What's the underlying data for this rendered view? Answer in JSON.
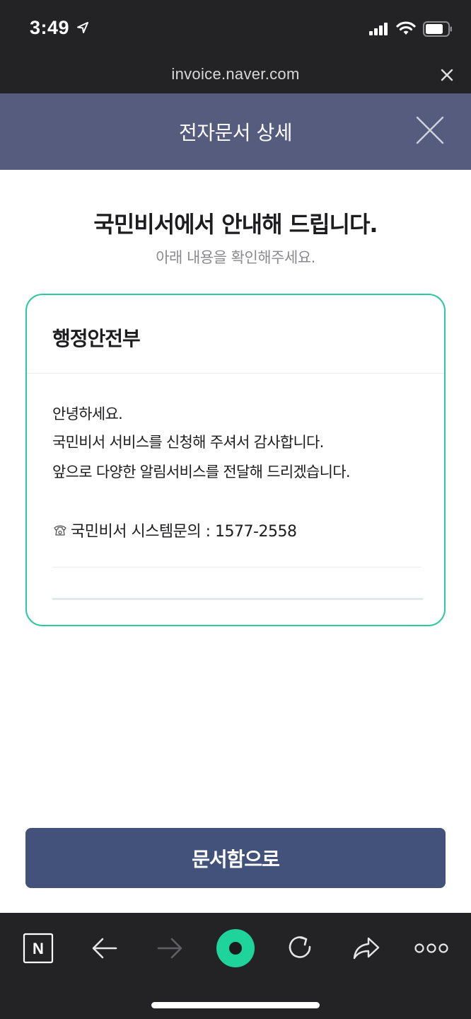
{
  "status_bar": {
    "time": "3:49"
  },
  "url_bar": {
    "url": "invoice.naver.com"
  },
  "header": {
    "title": "전자문서 상세"
  },
  "intro": {
    "title": "국민비서에서 안내해 드립니다.",
    "subtitle": "아래 내용을 확인해주세요."
  },
  "card": {
    "sender": "행정안전부",
    "lines": [
      "안녕하세요.",
      "국민비서 서비스를 신청해 주셔서 감사합니다.",
      "앞으로 다양한 알림서비스를 전달해 드리겠습니다."
    ],
    "phone_text": "국민비서 시스템문의 : 1577-2558"
  },
  "cta": {
    "label": "문서함으로"
  },
  "toolbar": {
    "n_label": "N"
  },
  "colors": {
    "header_bg": "#555c7e",
    "card_border": "#2cc9a1",
    "cta_bg": "#42527a",
    "green_accent": "#1ed49a",
    "chrome_bg": "#232326"
  },
  "icons": [
    "location-arrow-icon",
    "signal-icon",
    "wifi-icon",
    "battery-icon",
    "close-icon",
    "phone-icon",
    "naver-n-icon",
    "back-arrow-icon",
    "forward-arrow-icon",
    "green-dot-icon",
    "reload-icon",
    "share-icon",
    "more-icon"
  ]
}
